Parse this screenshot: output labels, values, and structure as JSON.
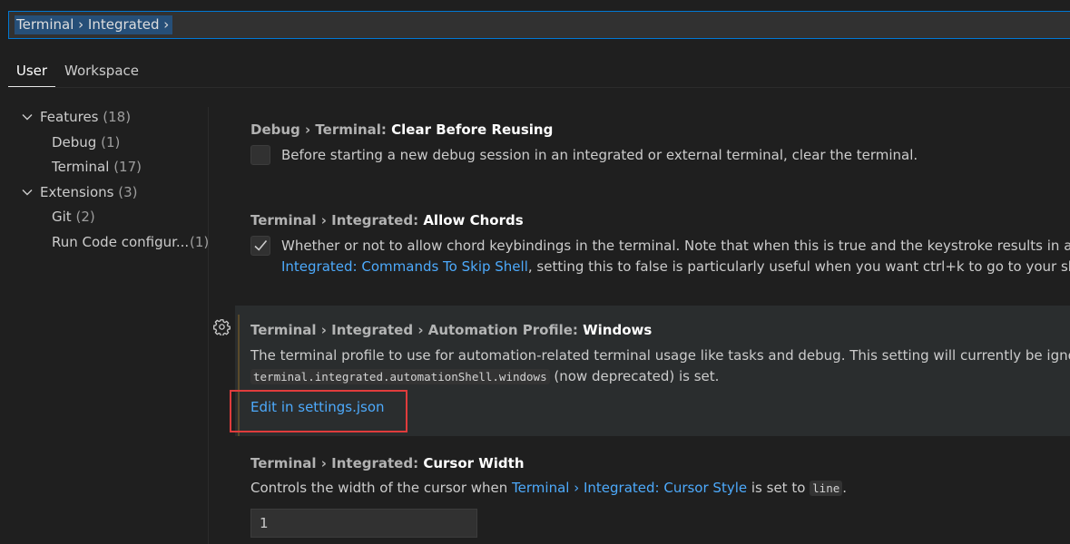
{
  "search": {
    "value": "Terminal › Integrated ›"
  },
  "tabs": [
    {
      "label": "User",
      "active": true
    },
    {
      "label": "Workspace",
      "active": false
    }
  ],
  "toc": {
    "features": {
      "label": "Features",
      "count": "(18)"
    },
    "debug": {
      "label": "Debug",
      "count": "(1)"
    },
    "terminal": {
      "label": "Terminal",
      "count": "(17)"
    },
    "extensions": {
      "label": "Extensions",
      "count": "(3)"
    },
    "git": {
      "label": "Git",
      "count": "(2)"
    },
    "runcode": {
      "label": "Run Code configur...",
      "count": "(1)"
    }
  },
  "settings": {
    "clear_before_reusing": {
      "category": "Debug › Terminal: ",
      "name": "Clear Before Reusing",
      "description": "Before starting a new debug session in an integrated or external terminal, clear the terminal.",
      "checked": false
    },
    "allow_chords": {
      "category": "Terminal › Integrated: ",
      "name": "Allow Chords",
      "description_1": "Whether or not to allow chord keybindings in the terminal. Note that when this is true and the keystroke results in a chord",
      "link": "Integrated: Commands To Skip Shell",
      "description_2": ", setting this to false is particularly useful when you want ctrl+k to go to your shell (no",
      "checked": true
    },
    "automation_profile": {
      "category": "Terminal › Integrated › Automation Profile: ",
      "name": "Windows",
      "description_1": "The terminal profile to use for automation-related terminal usage like tasks and debug. This setting will currently be ignored if",
      "code": "terminal.integrated.automationShell.windows",
      "description_2": " (now deprecated) is set.",
      "edit_link": "Edit in settings.json"
    },
    "cursor_width": {
      "category": "Terminal › Integrated: ",
      "name": "Cursor Width",
      "description_1": "Controls the width of the cursor when ",
      "link": "Terminal › Integrated: Cursor Style",
      "description_2": " is set to ",
      "code": "line",
      "description_3": ".",
      "value": "1"
    }
  },
  "colors": {
    "background": "#1f1f1f",
    "focus_border": "#0078d4",
    "link": "#4daafc",
    "highlight_box": "#e03c3c"
  }
}
